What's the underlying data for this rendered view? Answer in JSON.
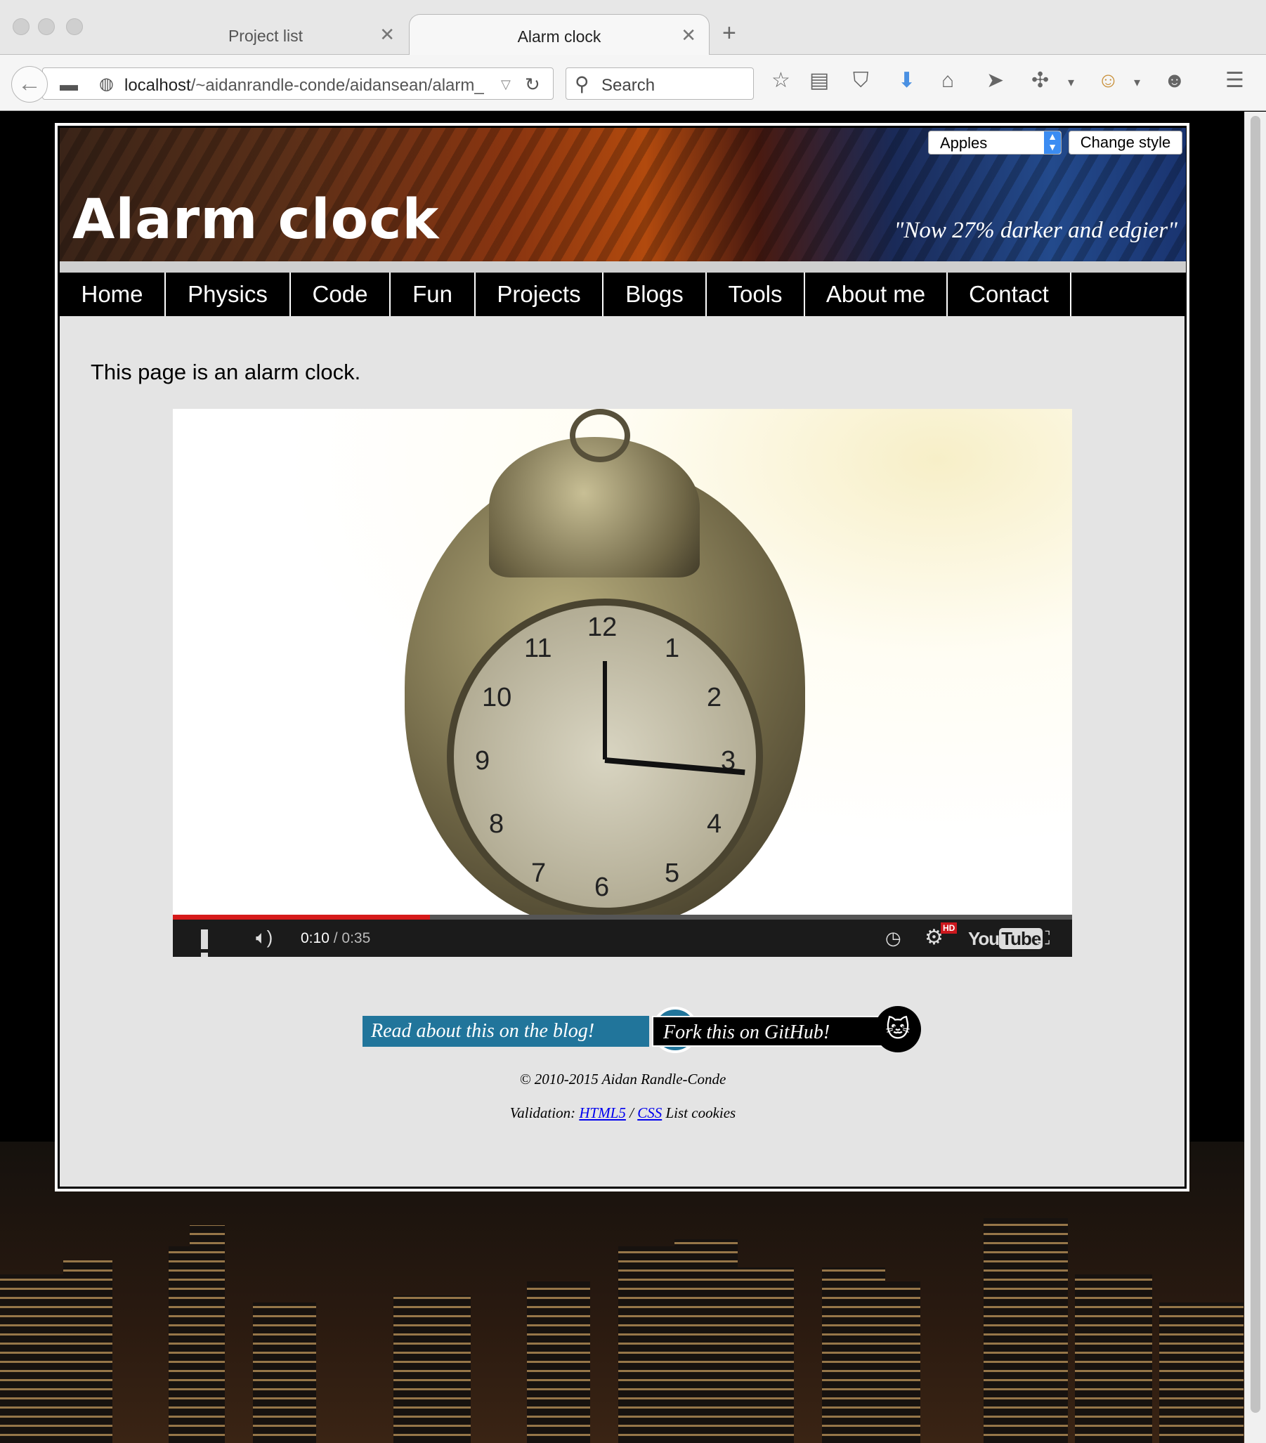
{
  "browser": {
    "tabs": [
      {
        "label": "Project list",
        "active": false
      },
      {
        "label": "Alarm clock",
        "active": true
      }
    ],
    "url_host": "localhost",
    "url_path": "/~aidanrandle-conde/aidansean/alarm_",
    "search_placeholder": "Search"
  },
  "banner": {
    "title": "Alarm clock",
    "tagline": "\"Now 27% darker and edgier\"",
    "style_selected": "Apples",
    "style_button": "Change style"
  },
  "menu": {
    "items": [
      "Home",
      "Physics",
      "Code",
      "Fun",
      "Projects",
      "Blogs",
      "Tools",
      "About me",
      "Contact"
    ]
  },
  "content": {
    "intro": "This page is an alarm clock."
  },
  "video": {
    "current_time": "0:10",
    "duration": "/ 0:35",
    "progress_fraction": 0.286,
    "hd_badge": "HD",
    "youtube_you": "You",
    "youtube_tube": "Tube",
    "clock_numerals": [
      "12",
      "1",
      "2",
      "3",
      "4",
      "5",
      "6",
      "7",
      "8",
      "9",
      "10",
      "11"
    ]
  },
  "footer": {
    "blog_link": "Read about this on the blog!",
    "github_link": "Fork this on GitHub!",
    "copyright": "© 2010-2015 Aidan Randle-Conde",
    "validation_prefix": "Validation:",
    "html5_link": "HTML5",
    "separator": "/",
    "css_link": "CSS",
    "cookies_link": "List cookies"
  },
  "colors": {
    "menu_bg": "#000000",
    "page_bg": "#e4e4e4",
    "progress_played": "#d61a1a",
    "wordpress_blue": "#21759b",
    "link_blue": "#0000ee"
  }
}
